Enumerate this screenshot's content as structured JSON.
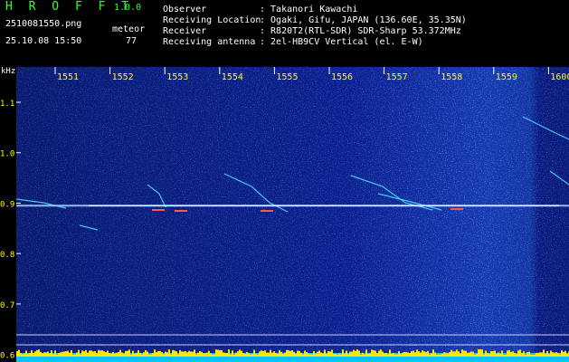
{
  "header": {
    "logo": "H R O F F T",
    "version": "1.0.0",
    "filename": "2510081550.png",
    "datetime": "25.10.08 15:50",
    "event_label": "meteor",
    "event_count": "77"
  },
  "station": [
    {
      "key": "Observer",
      "value": ": Takanori Kawachi"
    },
    {
      "key": "Receiving Location",
      "value": ": Ogaki, Gifu, JAPAN (136.60E, 35.35N)"
    },
    {
      "key": "Receiver",
      "value": ": R820T2(RTL-SDR) SDR-Sharp 53.372MHz"
    },
    {
      "key": "Receiving antenna",
      "value": ": 2el-HB9CV Vertical (el. E-W)"
    }
  ],
  "plot": {
    "y_unit": "kHz",
    "y_ticks": [
      "1.1",
      "1.0",
      "0.9",
      "0.8",
      "0.7",
      "0.6"
    ],
    "y_tick_values": [
      1.1,
      1.0,
      0.9,
      0.8,
      0.7,
      0.6
    ],
    "y_range": [
      0.585,
      1.17
    ],
    "x_ticks": [
      "1551",
      "1552",
      "1553",
      "1554",
      "1555",
      "1556",
      "1557",
      "1558",
      "1559",
      "1600"
    ],
    "carrier_khz": 0.895,
    "colors": {
      "label": "#ffff00",
      "tick": "#ffffff",
      "background": "#0a1a7a",
      "carrier": "#ffffff"
    }
  }
}
